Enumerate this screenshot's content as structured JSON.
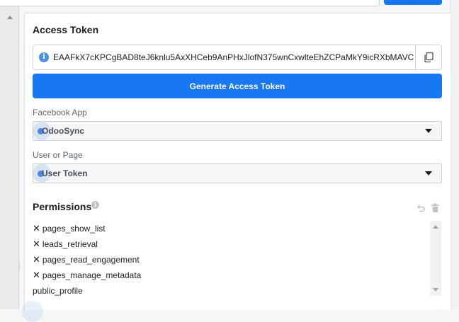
{
  "access_token": {
    "title": "Access Token",
    "value": "EAAFkX7cKPCgBAD8teJ6knlu5AxXHCeb9AnPHxJlofN375wnCxwlteEhZCPaMkY9icRXbMAVC"
  },
  "generate_button": {
    "label": "Generate Access Token"
  },
  "facebook_app": {
    "label": "Facebook App",
    "selected": "OdooSync"
  },
  "user_or_page": {
    "label": "User or Page",
    "selected": "User Token"
  },
  "permissions": {
    "title": "Permissions",
    "items": [
      {
        "label": "pages_show_list",
        "removable": true
      },
      {
        "label": "leads_retrieval",
        "removable": true
      },
      {
        "label": "pages_read_engagement",
        "removable": true
      },
      {
        "label": "pages_manage_metadata",
        "removable": true
      },
      {
        "label": "public_profile",
        "removable": false
      }
    ],
    "remove_glyph": "✕"
  },
  "icons": {
    "info": "info-icon",
    "copy": "copy-icon",
    "undo": "undo-icon",
    "trash": "trash-icon",
    "caret": "caret-down-icon"
  },
  "colors": {
    "accent": "#1877f2",
    "dot": "#4a86e8"
  }
}
